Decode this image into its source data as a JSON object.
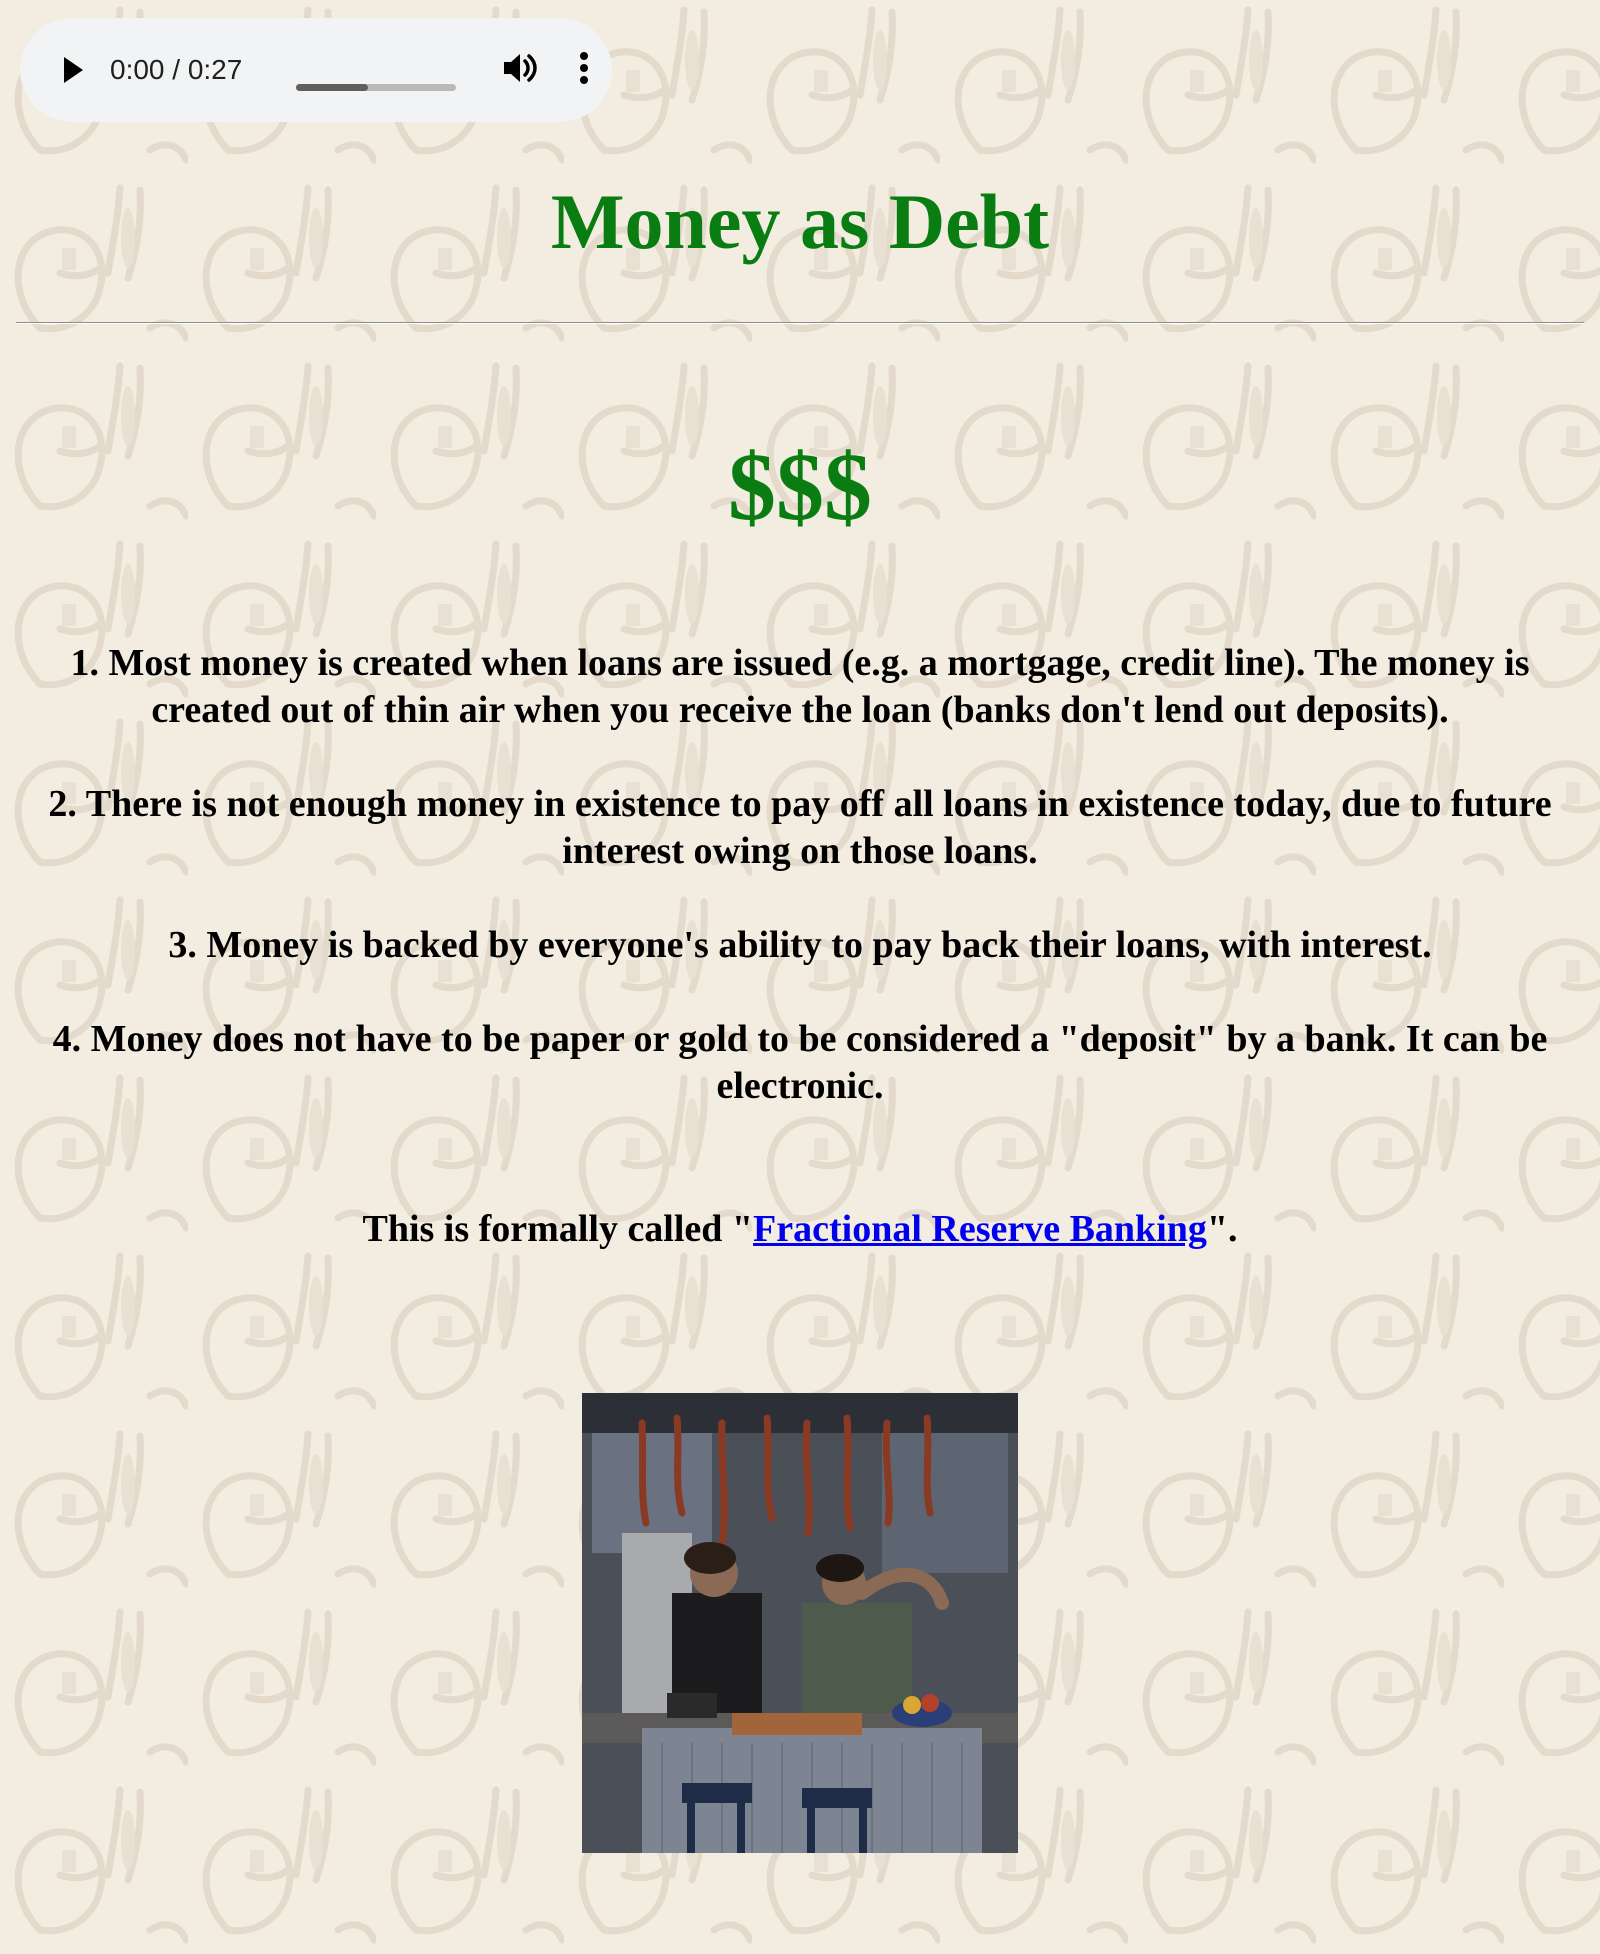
{
  "theme": {
    "title_color": "#0a7d12",
    "link_color": "#0000ee",
    "background_color": "#f3ece1",
    "pattern_color": "#e4dccd"
  },
  "audio_player": {
    "play_icon": "play-icon",
    "time_display": "0:00 / 0:27",
    "progress_fraction": 0.45,
    "volume_icon": "volume-icon",
    "more_icon": "more-vert-icon"
  },
  "page": {
    "title": "Money as Debt",
    "dollars": "$$$",
    "points": [
      "1. Most money is created when loans are issued (e.g. a mortgage, credit line). The money is created out of thin air when you receive the loan (banks don't lend out deposits).",
      "2. There is not enough money in existence to pay off all loans in existence today, due to future interest owing on those loans.",
      "3. Money is backed by everyone's ability to pay back their loans, with interest.",
      "4. Money does not have to be paper or gold to be considered a \"deposit\" by a bank. It can be electronic."
    ],
    "formally": {
      "prefix": "This is formally called \"",
      "link_text": "Fractional Reserve Banking",
      "suffix": "\"."
    }
  }
}
